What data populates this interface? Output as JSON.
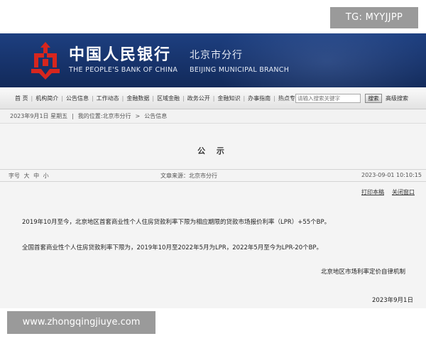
{
  "watermarks": {
    "top": "TG: MYYJJPP",
    "bottom": "www.zhongqingjiuye.com"
  },
  "header": {
    "bank_name_cn": "中国人民银行",
    "branch_cn": "北京市分行",
    "bank_name_en": "THE PEOPLE'S BANK OF CHINA",
    "branch_en": "BEIJING MUNICIPAL BRANCH"
  },
  "nav": {
    "items": [
      "首  页",
      "机构简介",
      "公告信息",
      "工作动态",
      "金融数据",
      "区域金融",
      "政务公开",
      "金融知识",
      "办事指南",
      "热点专题"
    ],
    "search_placeholder": "请输入搜索关键字",
    "search_button": "搜索",
    "advanced_search": "高级搜索"
  },
  "breadcrumb": {
    "date": "2023年9月1日 星期五",
    "location_label": "我的位置:北京市分行",
    "current": "公告信息"
  },
  "article": {
    "title": "公 示",
    "font_size_label": "字号",
    "font_sizes": [
      "大",
      "中",
      "小"
    ],
    "source": "文章来源：北京市分行",
    "datetime": "2023-09-01 10:10:15",
    "print": "打印本稿",
    "close": "关闭窗口",
    "paragraph_1": "2019年10月至今，北京地区首套商业性个人住房贷款利率下限为相应期限的贷款市场报价利率（LPR）+55个BP。",
    "paragraph_2": "全国首套商业性个人住房贷款利率下限为，2019年10月至2022年5月为LPR，2022年5月至今为LPR-20个BP。",
    "signature": "北京地区市场利率定价自律机制",
    "sign_date": "2023年9月1日"
  },
  "colors": {
    "banner": "#17336b",
    "logo_red": "#d7261e"
  }
}
